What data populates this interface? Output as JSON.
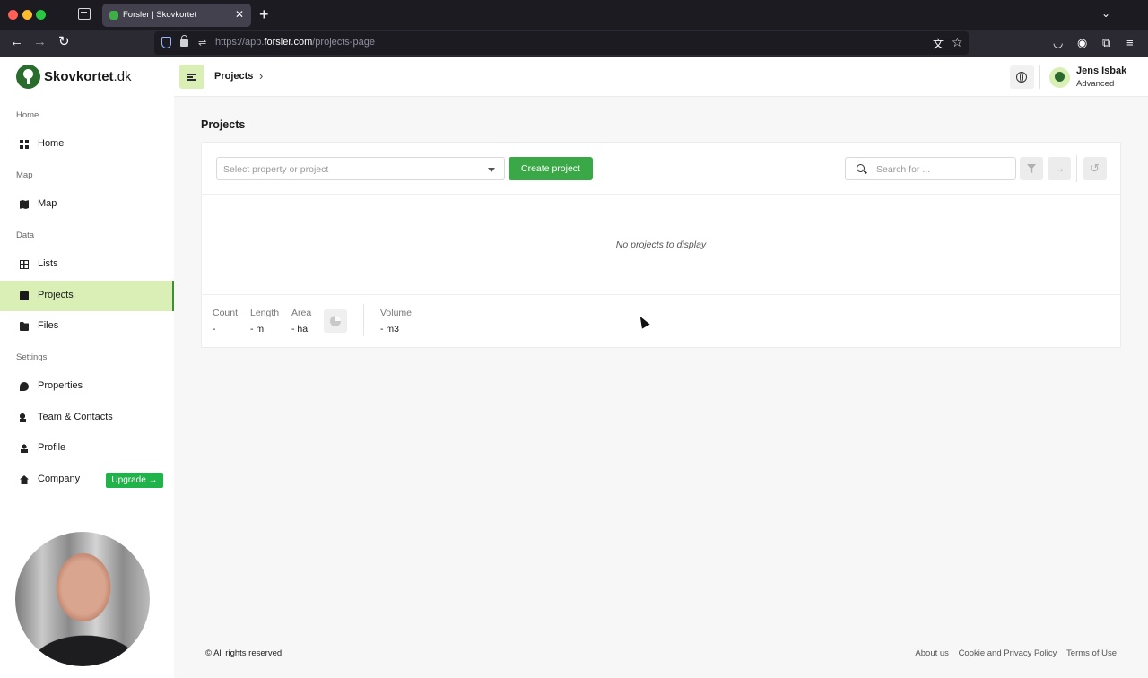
{
  "browser": {
    "tab_title": "Forsler | Skovkortet",
    "url_prefix": "https://app.",
    "url_host": "forsler.com",
    "url_path": "/projects-page"
  },
  "brand": {
    "name": "Skovkortet",
    "tld": ".dk",
    "accent": "#3aa847",
    "highlight": "#d9efb6"
  },
  "sidebar": {
    "sections": [
      {
        "label": "Home"
      },
      {
        "label": "Map"
      },
      {
        "label": "Data"
      },
      {
        "label": "Settings"
      }
    ],
    "items": [
      {
        "label": "Home",
        "icon": "dashboard-icon"
      },
      {
        "label": "Map",
        "icon": "map-icon"
      },
      {
        "label": "Lists",
        "icon": "table-icon"
      },
      {
        "label": "Projects",
        "icon": "clipboard-icon",
        "active": true
      },
      {
        "label": "Files",
        "icon": "folder-icon"
      },
      {
        "label": "Properties",
        "icon": "map-pin-icon"
      },
      {
        "label": "Team & Contacts",
        "icon": "team-icon"
      },
      {
        "label": "Profile",
        "icon": "profile-icon"
      },
      {
        "label": "Company",
        "icon": "house-icon"
      }
    ],
    "upgrade_label": "Upgrade →"
  },
  "header": {
    "breadcrumb": "Projects",
    "user_name": "Jens Isbak",
    "user_role": "Advanced"
  },
  "main": {
    "title": "Projects",
    "select_placeholder": "Select property or project",
    "create_label": "Create project",
    "search_placeholder": "Search for ...",
    "empty_message": "No projects to display",
    "stats": [
      {
        "label": "Count",
        "value": "-"
      },
      {
        "label": "Length",
        "value": "- m"
      },
      {
        "label": "Area",
        "value": "- ha"
      },
      {
        "label": "Volume",
        "value": "- m3"
      }
    ]
  },
  "footer": {
    "copyright": "© All rights reserved.",
    "links": [
      "About us",
      "Cookie and Privacy Policy",
      "Terms of Use"
    ]
  }
}
